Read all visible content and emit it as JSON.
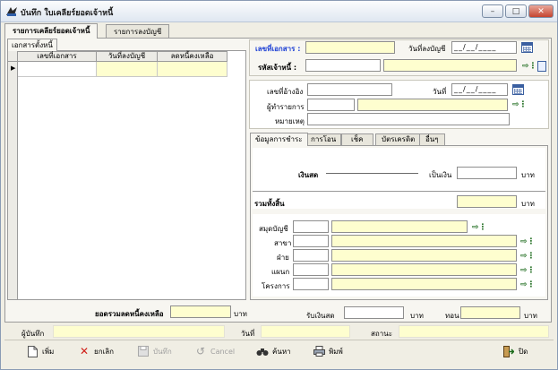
{
  "window": {
    "title": "บันทึก ใบเคลียร์ยอดเจ้าหนี้",
    "minimize": "–",
    "maximize": "□",
    "close": "✕"
  },
  "main_tabs": [
    {
      "label": "รายการเคลียร์ยอดเจ้าหนี้"
    },
    {
      "label": "รายการลงบัญชี"
    }
  ],
  "left": {
    "subtab": "เอกสารตั้งหนี้",
    "columns": [
      "เลขที่เอกสาร",
      "วันที่ลงบัญชี",
      "ลดหนี้คงเหลือ"
    ],
    "total_label": "ยอดรวมลดหนี้คงเหลือ",
    "total_value": "",
    "total_unit": "บาท"
  },
  "header": {
    "doc_no_label": "เลขที่เอกสาร :",
    "doc_no_value": "",
    "posting_date_label": "วันที่ลงบัญชี",
    "posting_date_value": "__/__/____",
    "creditor_label": "รหัสเจ้าหนี้ :",
    "creditor_code": "",
    "creditor_name": ""
  },
  "ref": {
    "ref_no_label": "เลขที่อ้างอิง",
    "ref_no_value": "",
    "date_label": "วันที่",
    "date_value": "__/__/____",
    "maker_label": "ผู้ทำรายการ",
    "maker_code": "",
    "maker_name": "",
    "remark_label": "หมายเหตุ",
    "remark_value": ""
  },
  "pay_tabs": [
    {
      "label": "ข้อมูลการชำระ"
    },
    {
      "label": "การโอน"
    },
    {
      "label": "เช็ค"
    },
    {
      "label": "บัตรเครดิต"
    },
    {
      "label": "อื่นๆ"
    }
  ],
  "payment": {
    "cash_label": "เงินสด",
    "as_money_label": "เป็นเงิน",
    "cash_value": "",
    "unit": "บาท",
    "total_label": "รวมทั้งสิ้น",
    "total_value": "",
    "book_label": "สมุดบัญชี",
    "branch_label": "สาขา",
    "division_label": "ฝ่าย",
    "dept_label": "แผนก",
    "project_label": "โครงการ"
  },
  "receive": {
    "receive_label": "รับเงินสด",
    "receive_value": "",
    "receive_unit": "บาท",
    "change_label": "ทอน",
    "change_value": "",
    "change_unit": "บาท"
  },
  "status_bar": {
    "recorder_label": "ผู้บันทึก",
    "recorder_value": "",
    "date_label": "วันที่",
    "date_value": "",
    "status_label": "สถานะ",
    "status_value": ""
  },
  "toolbar": {
    "add": "เพิ่ม",
    "cancel_edit": "ยกเลิก",
    "save": "บันทึก",
    "cancel": "Cancel",
    "search": "ค้นหา",
    "print": "พิมพ์",
    "close": "ปิด"
  },
  "colors": {
    "input_yellow": "#fefecf",
    "label_blue": "#1c3fd4"
  }
}
